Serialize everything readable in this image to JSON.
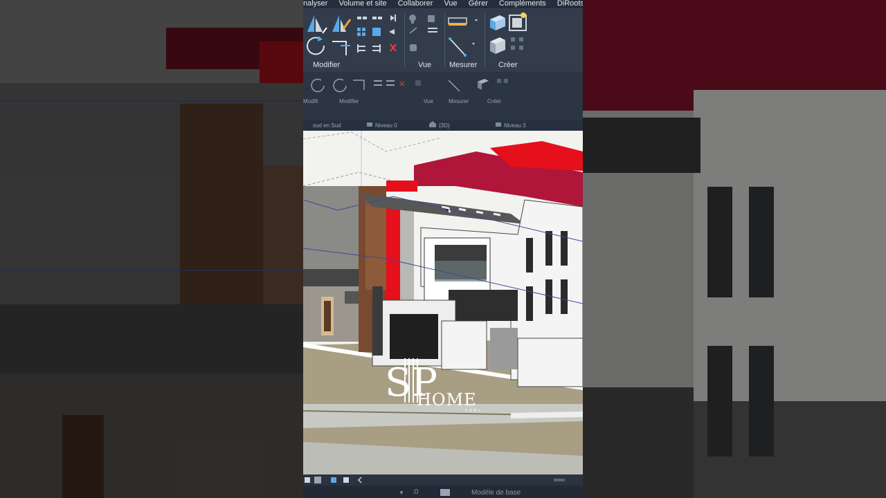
{
  "menubar": {
    "items": [
      "nalyser",
      "Volume et site",
      "Collaborer",
      "Vue",
      "Gérer",
      "Compléments",
      "DiRoots"
    ]
  },
  "ribbon": {
    "groups": [
      "Modifier",
      "Vue",
      "Mesurer",
      "Créer"
    ]
  },
  "ribbon_secondary": {
    "groups": [
      "Modifi",
      "Modifier",
      "Vue",
      "Mesurer",
      "Créer"
    ]
  },
  "view_tabs": {
    "items": [
      "sud en Sud",
      "Niveau 0",
      "{3D}",
      "Niveau 3"
    ]
  },
  "logo": {
    "monogram": "SP",
    "brand": "HOME",
    "sub": "SARL"
  },
  "statusbar": {
    "scale_value": ":0",
    "model_label": "Modèle de base"
  },
  "colors": {
    "accent_red": "#e5101b",
    "roof_crimson": "#b0163a",
    "ui_dark": "#2b3442"
  }
}
